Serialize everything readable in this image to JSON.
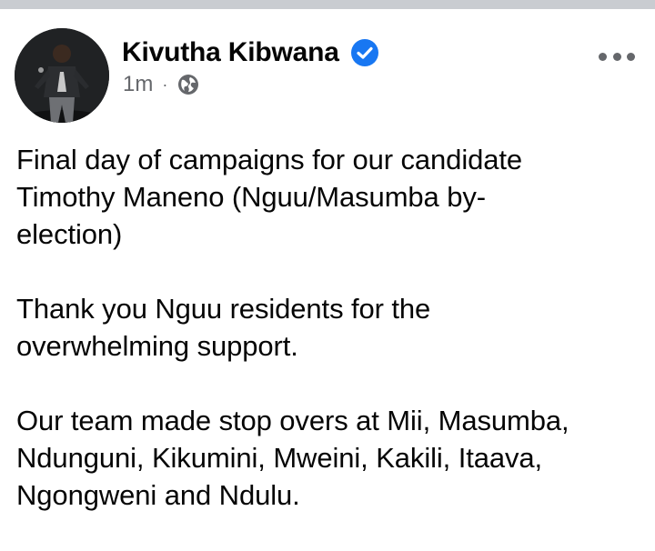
{
  "post": {
    "author": {
      "name": "Kivutha Kibwana",
      "verified": true,
      "avatar_icon": "profile-photo"
    },
    "meta": {
      "timestamp": "1m",
      "separator": "·",
      "audience_icon": "globe-icon"
    },
    "menu_icon": "more-options-icon",
    "body": {
      "paragraphs": [
        {
          "lines": [
            "Final day of campaigns for our candidate",
            "Timothy Maneno (Nguu/Masumba by-",
            "election)"
          ]
        },
        {
          "lines": [
            "Thank you Nguu residents for the",
            "overwhelming support."
          ]
        },
        {
          "lines": [
            "Our team made stop overs at Mii, Masumba,",
            "Ndunguni, Kikumini, Mweini, Kakili, Itaava,",
            "Ngongweni and Ndulu."
          ]
        }
      ]
    }
  },
  "colors": {
    "verified_badge": "#1877f2",
    "text_primary": "#050505",
    "text_secondary": "#65676b",
    "top_strip": "#c9ccd1"
  }
}
